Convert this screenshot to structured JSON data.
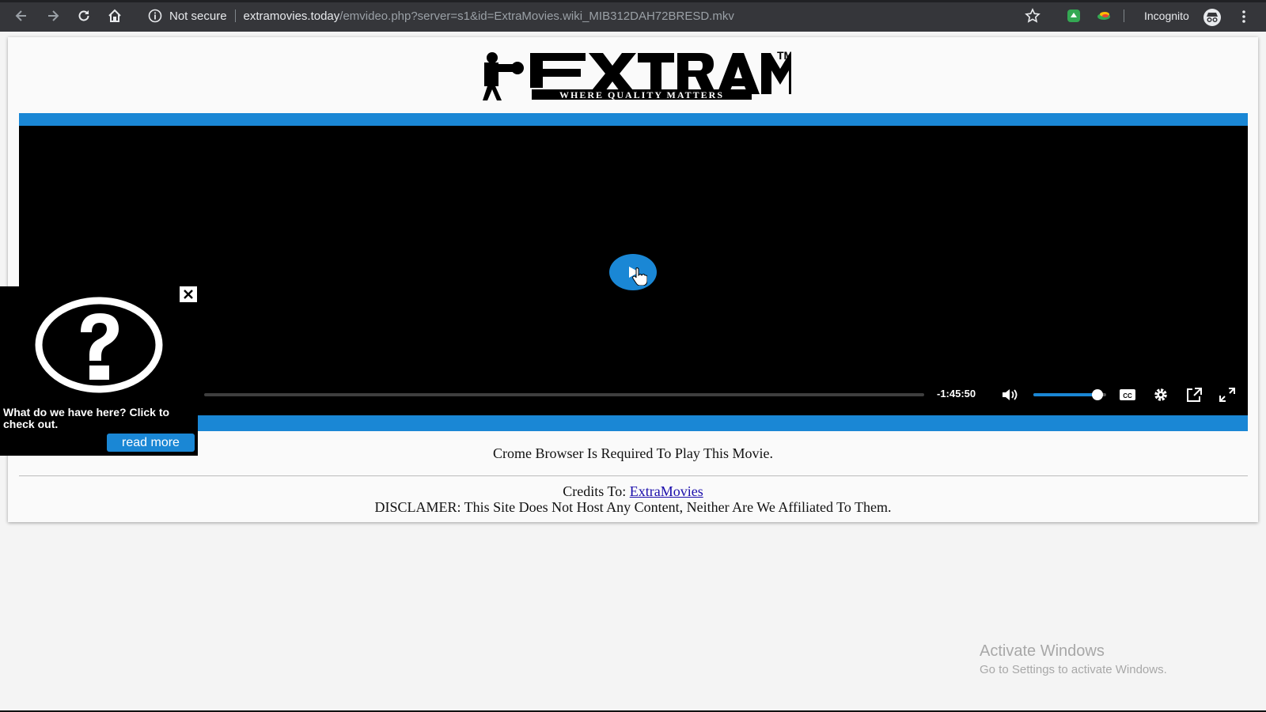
{
  "browser": {
    "security_label": "Not secure",
    "url_domain": "extramovies.today",
    "url_path": "/emvideo.php?server=s1&id=ExtraMovies.wiki_MIB312DAH72BRESD.mkv",
    "profile_label": "Incognito"
  },
  "logo": {
    "text": "EXTRAMOVIES",
    "tagline": "WHERE QUALITY MATTERS",
    "trademark": "TM"
  },
  "player": {
    "time_remaining": "-1:45:50",
    "volume_fraction": 0.88,
    "progress_fraction": 0,
    "accent_color": "#1a87d5"
  },
  "page": {
    "notice": "Crome Browser Is Required To Play This Movie.",
    "credits_prefix": "Credits To: ",
    "credits_link": "ExtraMovies",
    "disclaimer": "DISCLAMER: This Site Does Not Host Any Content, Neither Are We Affiliated To Them."
  },
  "popup": {
    "text": "What do we have here? Click to check out.",
    "button_label": "read more"
  },
  "watermark": {
    "line1": "Activate Windows",
    "line2": "Go to Settings to activate Windows."
  }
}
